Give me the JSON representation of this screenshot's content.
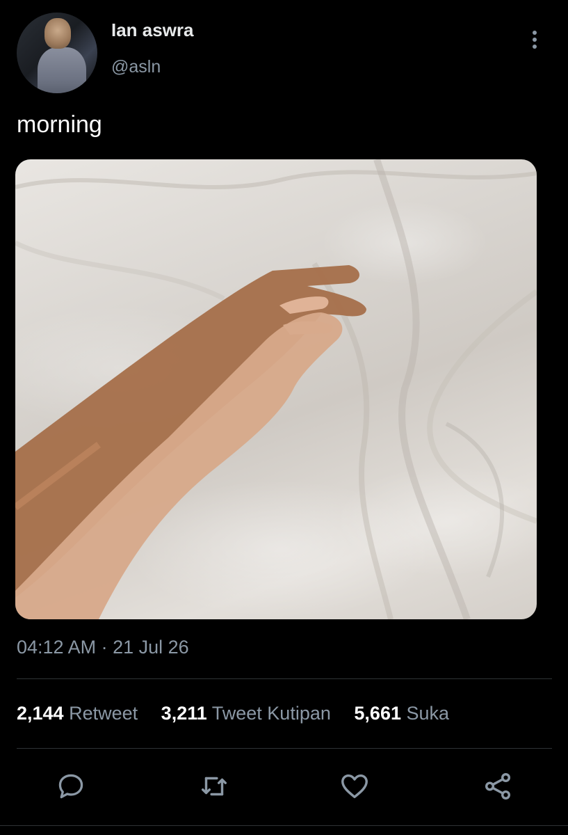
{
  "user": {
    "display_name": "Ian aswra",
    "handle": "@asln"
  },
  "tweet": {
    "text": "morning",
    "timestamp": "04:12 AM · 21 Jul 26"
  },
  "stats": [
    {
      "value": "2,144",
      "label": "Retweet"
    },
    {
      "value": "3,211",
      "label": "Tweet Kutipan"
    },
    {
      "value": "5,661",
      "label": "Suka"
    }
  ],
  "actions": [
    {
      "icon": "reply-icon"
    },
    {
      "icon": "retweet-icon"
    },
    {
      "icon": "like-icon"
    },
    {
      "icon": "share-icon"
    }
  ],
  "colors": {
    "background": "#000000",
    "primary_text": "#e7e9ea",
    "secondary_text": "#8b98a5",
    "divider": "#2f3336"
  }
}
